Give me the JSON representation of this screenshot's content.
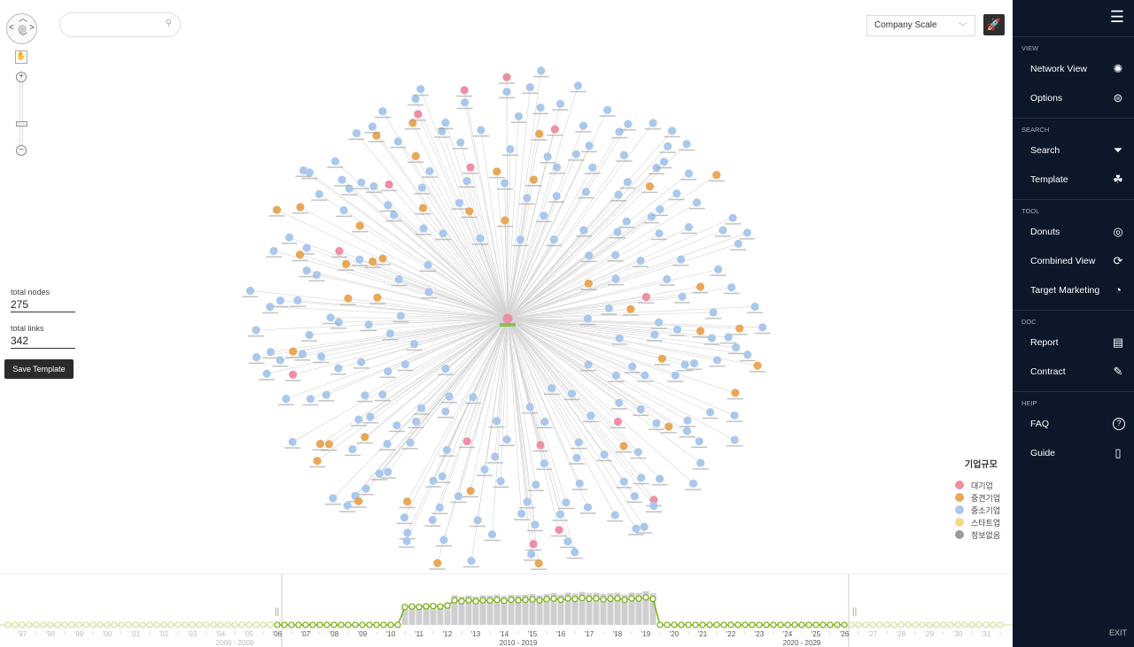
{
  "search": {
    "placeholder": "",
    "icon": "search-icon"
  },
  "stats": {
    "nodes_label": "total nodes",
    "nodes_value": "275",
    "links_label": "total links",
    "links_value": "342"
  },
  "save_template": "Save Template",
  "scale_select": {
    "value": "Company Scale"
  },
  "legend": {
    "title": "기업규모",
    "items": [
      {
        "label": "대기업",
        "color": "#ee8fa6"
      },
      {
        "label": "중견기업",
        "color": "#e8a857"
      },
      {
        "label": "중소기업",
        "color": "#a9c8ec"
      },
      {
        "label": "스타트업",
        "color": "#f5d98a"
      },
      {
        "label": "정보없음",
        "color": "#9b9b9b"
      }
    ]
  },
  "sidebar": {
    "sections": [
      {
        "title": "VIEW",
        "items": [
          {
            "label": "Network View",
            "icon": "network-icon"
          },
          {
            "label": "Options",
            "icon": "toggle-icon"
          }
        ]
      },
      {
        "title": "SEARCH",
        "items": [
          {
            "label": "Search",
            "icon": "filter-icon"
          },
          {
            "label": "Template",
            "icon": "template-icon"
          }
        ]
      },
      {
        "title": "TOOL",
        "items": [
          {
            "label": "Donuts",
            "icon": "donut-icon"
          },
          {
            "label": "Combined View",
            "icon": "combined-icon"
          },
          {
            "label": "Target Marketing",
            "icon": "target-icon"
          }
        ]
      },
      {
        "title": "DOC",
        "items": [
          {
            "label": "Report",
            "icon": "report-icon"
          },
          {
            "label": "Contract",
            "icon": "contract-icon"
          }
        ]
      },
      {
        "title": "HEIP",
        "items": [
          {
            "label": "FAQ",
            "icon": "help-icon"
          },
          {
            "label": "Guide",
            "icon": "guide-icon"
          }
        ]
      }
    ],
    "exit": "EXIT"
  },
  "timeline": {
    "year_labels": [
      "'97",
      "'98",
      "'99",
      "'00",
      "'01",
      "'02",
      "'03",
      "'04",
      "'05",
      "'06",
      "'07",
      "'08",
      "'09",
      "'10",
      "'11",
      "'12",
      "'13",
      "'14",
      "'15",
      "'16",
      "'17",
      "'18",
      "'19",
      "'20",
      "'21",
      "'22",
      "'23",
      "'24",
      "'25",
      "'26",
      "'27",
      "'28",
      "'29",
      "'30",
      "'31"
    ],
    "decades": [
      "2000 - 2009",
      "2010 - 2019",
      "2020 - 2029"
    ],
    "selected_range": [
      "'06",
      "'26"
    ],
    "active_bars": {
      "start": "2010 Q3",
      "end": "2018 Q4"
    },
    "bar_values": [
      60,
      62,
      60,
      63,
      64,
      62,
      66,
      88,
      84,
      88,
      84,
      88,
      87,
      90,
      86,
      90,
      88,
      90,
      92,
      88,
      92,
      95,
      90,
      96,
      93,
      98,
      94,
      96,
      92,
      94,
      96,
      90,
      96,
      95,
      100,
      94
    ],
    "line_color": "#7fb21e"
  }
}
